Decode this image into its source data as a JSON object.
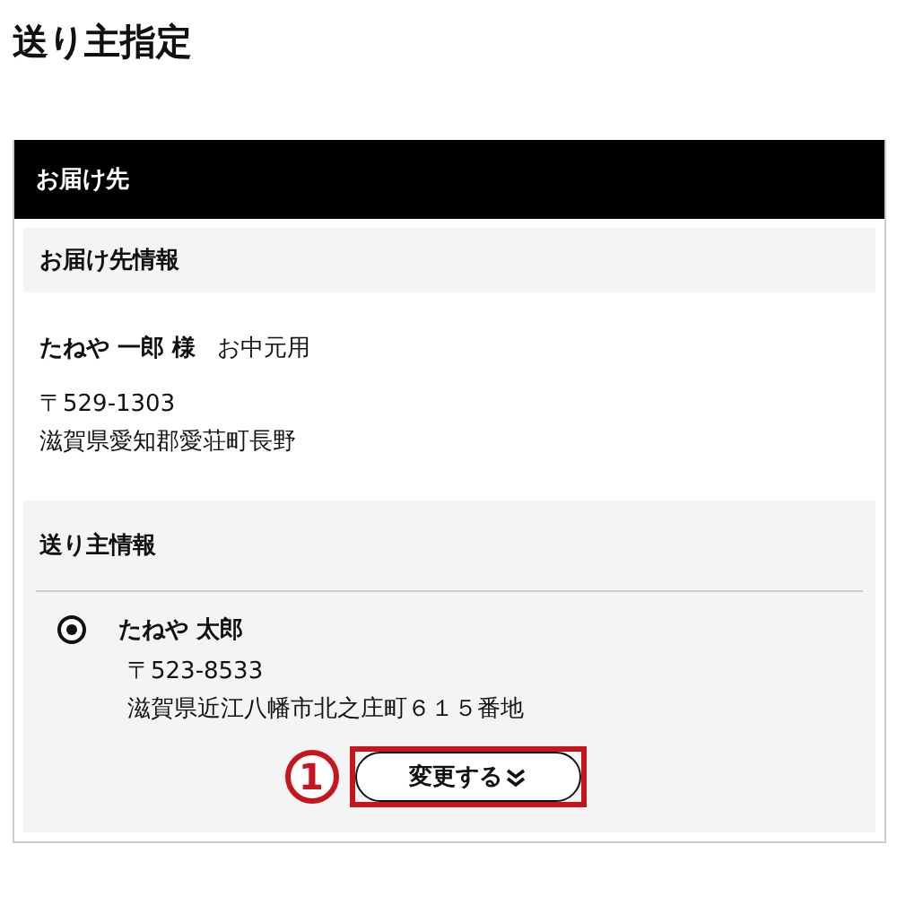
{
  "page_title": "送り主指定",
  "panel": {
    "header": "お届け先",
    "recipient": {
      "section_title": "お届け先情報",
      "name": "たねや 一郎 様",
      "tag": "お中元用",
      "postal": "〒529-1303",
      "address": "滋賀県愛知郡愛荘町長野"
    },
    "sender": {
      "section_title": "送り主情報",
      "options": [
        {
          "name": "たねや 太郎",
          "postal": "〒523-8533",
          "address": "滋賀県近江八幡市北之庄町６１５番地",
          "selected": true
        }
      ],
      "change_button": {
        "label": "変更する",
        "callout": "1"
      }
    }
  }
}
